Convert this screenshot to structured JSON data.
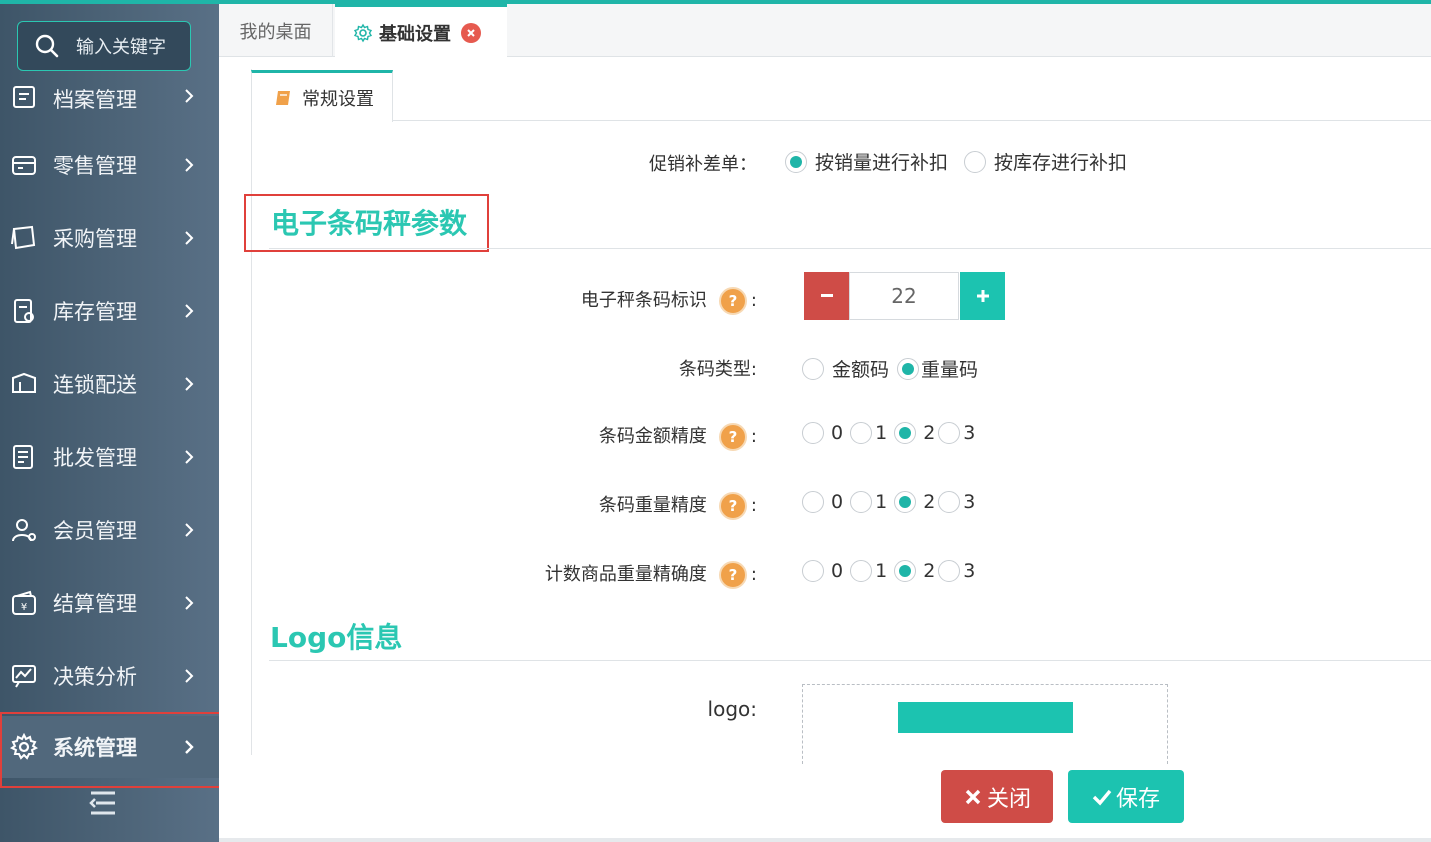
{
  "sidebar": {
    "search_placeholder": "输入关键字",
    "items": [
      {
        "label": "档案管理",
        "icon": "archive-icon"
      },
      {
        "label": "零售管理",
        "icon": "register-icon"
      },
      {
        "label": "采购管理",
        "icon": "purchase-icon"
      },
      {
        "label": "库存管理",
        "icon": "inventory-icon"
      },
      {
        "label": "连锁配送",
        "icon": "delivery-icon"
      },
      {
        "label": "批发管理",
        "icon": "wholesale-icon"
      },
      {
        "label": "会员管理",
        "icon": "member-icon"
      },
      {
        "label": "结算管理",
        "icon": "settlement-icon"
      },
      {
        "label": "决策分析",
        "icon": "analysis-icon"
      },
      {
        "label": "系统管理",
        "icon": "gear-icon",
        "active": true
      }
    ]
  },
  "tabs": {
    "desktop": "我的桌面",
    "basic": "基础设置"
  },
  "subtab": {
    "general": "常规设置"
  },
  "promo": {
    "label": "促销补差单：",
    "options": [
      "按销量进行补扣",
      "按库存进行补扣"
    ],
    "selected": 0
  },
  "scale_section": {
    "title": "电子条码秤参数",
    "barcode_id": {
      "label": "电子秤条码标识",
      "colon": ":",
      "value": "22"
    },
    "barcode_type": {
      "label": "条码类型:",
      "options": [
        "金额码",
        "重量码"
      ],
      "selected": 1
    },
    "amount_precision": {
      "label": "条码金额精度",
      "colon": ":",
      "options": [
        "0",
        "1",
        "2",
        "3"
      ],
      "selected": 2
    },
    "weight_precision": {
      "label": "条码重量精度",
      "colon": ":",
      "options": [
        "0",
        "1",
        "2",
        "3"
      ],
      "selected": 2
    },
    "count_precision": {
      "label": "计数商品重量精确度",
      "colon": ":",
      "options": [
        "0",
        "1",
        "2",
        "3"
      ],
      "selected": 2
    },
    "help_glyph": "?"
  },
  "logo_section": {
    "title": "Logo信息",
    "label": "logo:"
  },
  "buttons": {
    "close": "关闭",
    "save": "保存"
  },
  "colors": {
    "accent": "#1fb5a8",
    "danger": "#cf4c47",
    "help": "#f0a14a",
    "sidebar": "#4a6174"
  }
}
